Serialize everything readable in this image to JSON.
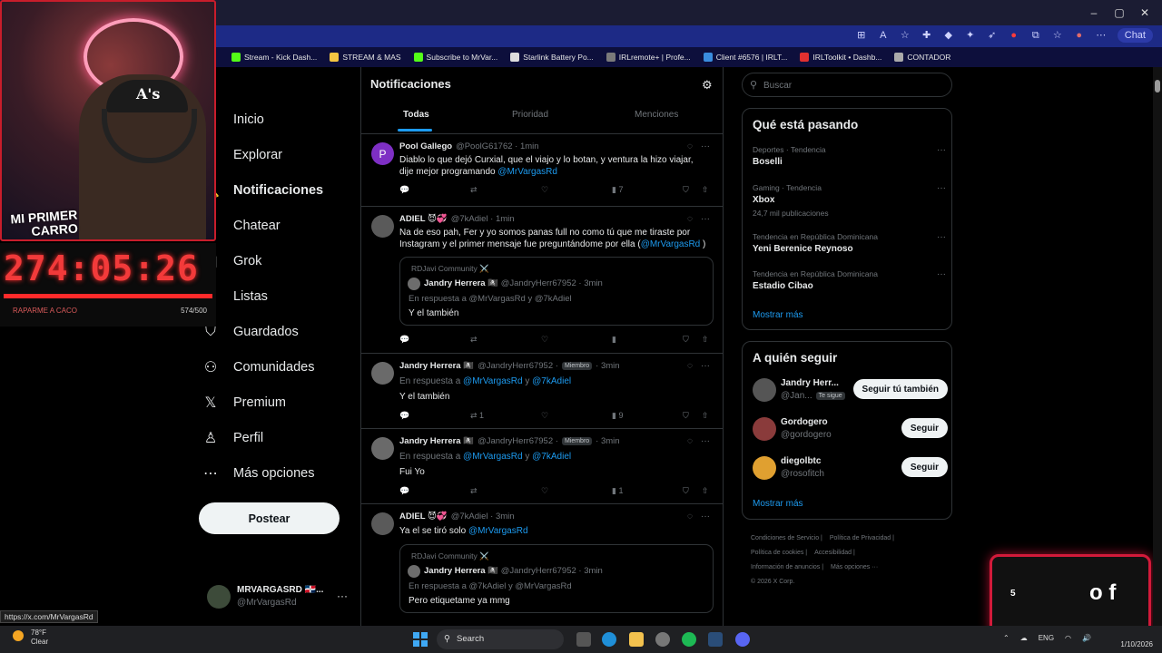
{
  "browser": {
    "chat_label": "Chat",
    "bookmarks": [
      {
        "label": "Stream - Kick Dash...",
        "color": "#53fc18"
      },
      {
        "label": "STREAM & MAS",
        "color": "#f4c542"
      },
      {
        "label": "Subscribe to MrVar...",
        "color": "#53fc18"
      },
      {
        "label": "Starlink Battery Po...",
        "color": "#dddddd"
      },
      {
        "label": "IRLremote+ | Profe...",
        "color": "#7a7a7a"
      },
      {
        "label": "Client #6576 | IRLT...",
        "color": "#3a8dde"
      },
      {
        "label": "IRLToolkit • Dashb...",
        "color": "#e03030"
      },
      {
        "label": "CONTADOR",
        "color": "#aaaaaa"
      }
    ]
  },
  "nav": {
    "items": [
      {
        "label": "Inicio",
        "icon": "home-icon",
        "glyph": "⌂"
      },
      {
        "label": "Explorar",
        "icon": "search-icon",
        "glyph": "⚲"
      },
      {
        "label": "Notificaciones",
        "icon": "bell-icon",
        "glyph": "🔔"
      },
      {
        "label": "Chatear",
        "icon": "chat-icon",
        "glyph": "✉"
      },
      {
        "label": "Grok",
        "icon": "grok-icon",
        "glyph": "◪"
      },
      {
        "label": "Listas",
        "icon": "list-icon",
        "glyph": "☰"
      },
      {
        "label": "Guardados",
        "icon": "bookmark-icon",
        "glyph": "⛉"
      },
      {
        "label": "Comunidades",
        "icon": "communities-icon",
        "glyph": "⚇"
      },
      {
        "label": "Premium",
        "icon": "x-logo-icon",
        "glyph": "𝕏"
      },
      {
        "label": "Perfil",
        "icon": "profile-icon",
        "glyph": "♙"
      },
      {
        "label": "Más opciones",
        "icon": "more-options-icon",
        "glyph": "⋯"
      }
    ],
    "post_label": "Postear",
    "account": {
      "name": "MRVARGASRD 🇩🇴...",
      "handle": "@MrVargasRd",
      "more": "···"
    }
  },
  "notifications": {
    "title": "Notificaciones",
    "tabs": [
      "Todas",
      "Prioridad",
      "Menciones"
    ],
    "tweets": [
      {
        "avatar_letter": "P",
        "avatar_color": "#7e2fc4",
        "name": "Pool Gallego",
        "handle": "@PoolG61762 · 1min",
        "body_prefix": "Diablo lo que dejó Curxial, que el viajo y lo botan, y ventura la hizo viajar, dije mejor programando ",
        "body_link": "@MrVargasRd",
        "actions": {
          "reply": "",
          "repost": "",
          "like": "",
          "views": "7"
        }
      },
      {
        "name": "ADIEL 😈💞",
        "handle": "@7kAdiel · 1min",
        "body_prefix": "Na de eso pah, Fer y yo somos panas full no como tú que me tiraste por Instagram y el primer mensaje fue preguntándome por ella (",
        "body_link": "@MrVargasRd",
        "body_suffix": " )",
        "quote": {
          "community": "RDJavi Community ⚔️",
          "name": "Jandry Herrera 🏴‍☠️",
          "handle": "@JandryHerr67952 · 3min",
          "reply_to": "En respuesta a @MrVargasRd y @7kAdiel",
          "body": "Y el también"
        }
      },
      {
        "name": "Jandry Herrera 🏴‍☠️",
        "handle": "@JandryHerr67952 ·",
        "badge": "Miembro",
        "time": "· 3min",
        "reply_prefix": "En respuesta a ",
        "reply_link1": "@MrVargasRd",
        "reply_mid": " y ",
        "reply_link2": "@7kAdiel",
        "body": "Y el también",
        "actions": {
          "repost": "1",
          "views": "9"
        }
      },
      {
        "name": "Jandry Herrera 🏴‍☠️",
        "handle": "@JandryHerr67952 ·",
        "badge": "Miembro",
        "time": "· 3min",
        "reply_prefix": "En respuesta a ",
        "reply_link1": "@MrVargasRd",
        "reply_mid": " y ",
        "reply_link2": "@7kAdiel",
        "body": "Fui Yo",
        "actions": {
          "views": "1"
        }
      },
      {
        "name": "ADIEL 😈💞",
        "handle": "@7kAdiel · 3min",
        "body_prefix": "Ya el se tiró solo ",
        "body_link": "@MrVargasRd",
        "quote": {
          "community": "RDJavi Community ⚔️",
          "name": "Jandry Herrera 🏴‍☠️",
          "handle": "@JandryHerr67952 · 3min",
          "reply_to": "En respuesta a @7kAdiel y @MrVargasRd",
          "body": "Pero etiquetame ya mmg"
        }
      }
    ]
  },
  "right": {
    "search_placeholder": "Buscar",
    "trending_title": "Qué está pasando",
    "trends": [
      {
        "category": "Deportes · Tendencia",
        "name": "Boselli",
        "count": ""
      },
      {
        "category": "Gaming · Tendencia",
        "name": "Xbox",
        "count": "24,7 mil publicaciones"
      },
      {
        "category": "Tendencia en República Dominicana",
        "name": "Yeni Berenice Reynoso",
        "count": ""
      },
      {
        "category": "Tendencia en República Dominicana",
        "name": "Estadio Cibao",
        "count": ""
      }
    ],
    "show_more": "Mostrar más",
    "follow_title": "A quién seguir",
    "follow": [
      {
        "name": "Jandry Herr...",
        "handle": "@Jan...",
        "tag": "Te sigue",
        "button": "Seguir tú también",
        "color": "#555"
      },
      {
        "name": "Gordogero",
        "handle": "@gordogero",
        "tag": "",
        "button": "Seguir",
        "color": "#8a3b3b"
      },
      {
        "name": "diegolbtc",
        "handle": "@rosofitch",
        "tag": "",
        "button": "Seguir",
        "color": "#e0a030"
      }
    ],
    "footer": [
      "Condiciones de Servicio |",
      "Política de Privacidad |",
      "Política de cookies |",
      "Accesibilidad |",
      "Información de anuncios |",
      "Más opciones ···",
      "© 2026 X Corp."
    ]
  },
  "overlay": {
    "cam_logo_line1": "MI PRIMER",
    "cam_logo_line2": "CARRO",
    "timer": "274:05:26",
    "goal_label": "RAPARME A CACO",
    "goal_count": "574/500",
    "goal_progress": 1.0,
    "widget_number": "5",
    "widget_text": "o f"
  },
  "status_url": "https://x.com/MrVargasRd",
  "taskbar": {
    "temp": "78°F",
    "cond": "Clear",
    "search_label": "Search",
    "lang": "ENG",
    "date": "1/10/2026"
  }
}
